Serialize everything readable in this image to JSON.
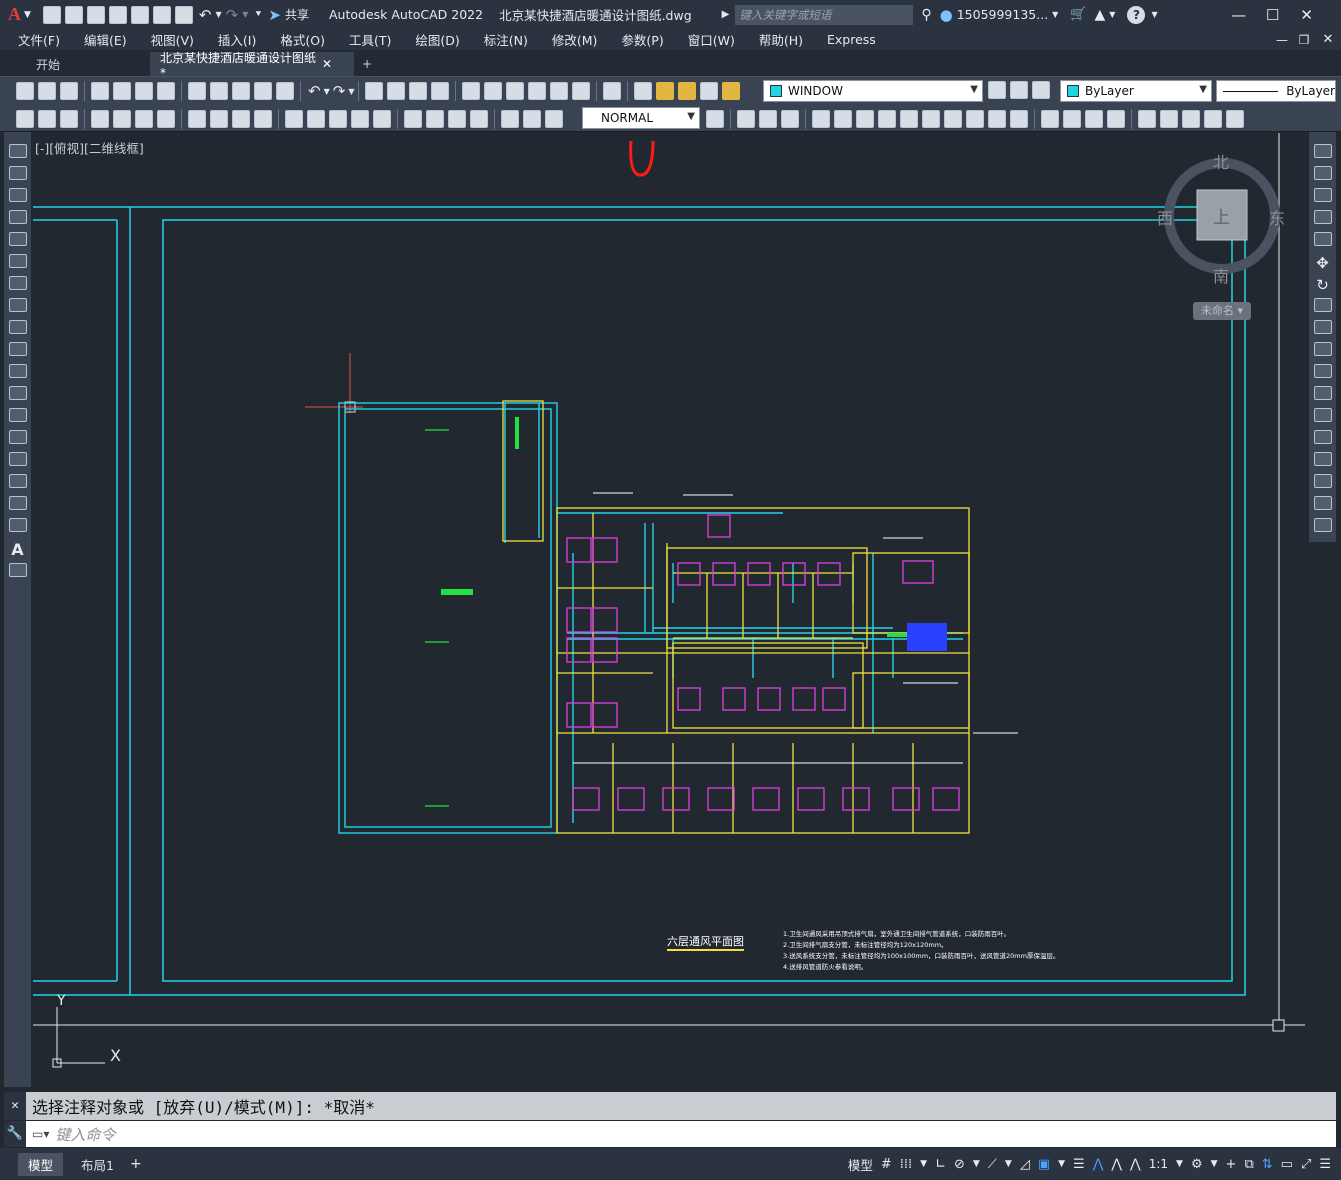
{
  "app": {
    "logo": "A",
    "title": "Autodesk AutoCAD 2022",
    "filename": "北京某快捷酒店暖通设计图纸.dwg",
    "search_placeholder": "键入关键字或短语",
    "user": "1505999135...",
    "share_label": "共享",
    "help": "?"
  },
  "menu": [
    "文件(F)",
    "编辑(E)",
    "视图(V)",
    "插入(I)",
    "格式(O)",
    "工具(T)",
    "绘图(D)",
    "标注(N)",
    "修改(M)",
    "参数(P)",
    "窗口(W)",
    "帮助(H)",
    "Express"
  ],
  "tabs": {
    "start": "开始",
    "drawing": "北京某快捷酒店暖通设计图纸*",
    "add": "+"
  },
  "toolbar": {
    "layer": "WINDOW",
    "color": "ByLayer",
    "linetype": "ByLayer",
    "textstyle": "NORMAL",
    "layer_color": "#22d3e6",
    "color_swatch": "#22d3e6"
  },
  "viewport": {
    "label": "[-][俯视][二维线框]",
    "compass": {
      "north": "北",
      "south": "南",
      "east": "东",
      "west": "西",
      "top": "上",
      "ucs": "未命名"
    },
    "ucs_x": "X",
    "ucs_y": "Y"
  },
  "drawing": {
    "plan_title": "六层通风平面图",
    "notes": [
      "1.卫生间通风采用吊顶式排气扇，室外通卫生间排气管道系统，口装防雨百叶。",
      "2.卫生间排气扇支分管，未标注管径均为120x120mm。",
      "3.送风系统支分管，未标注管径均为100x100mm，口装防雨百叶，送风管道20mm厚保温层。",
      "4.送排风管道防火参看说明。"
    ]
  },
  "command": {
    "history": "选择注释对象或 [放弃(U)/模式(M)]: *取消*",
    "placeholder": "键入命令"
  },
  "status": {
    "tabs": [
      "模型",
      "布局1"
    ],
    "add": "+",
    "model_btn": "模型",
    "scale": "1:1"
  }
}
